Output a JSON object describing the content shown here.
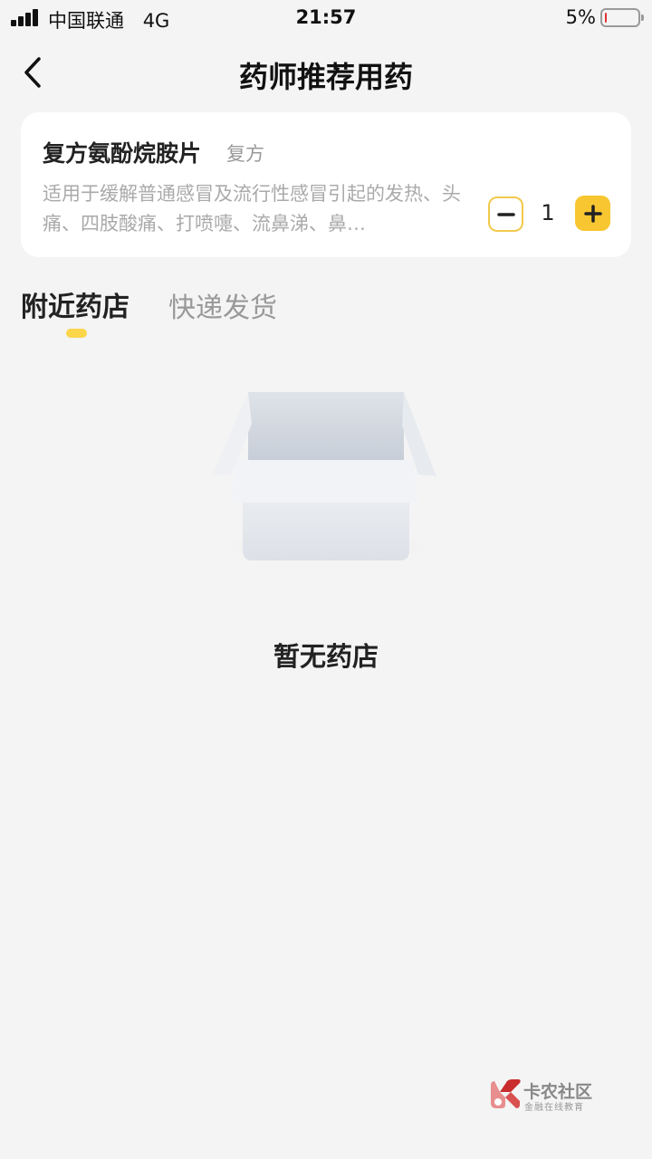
{
  "status_bar": {
    "carrier": "中国联通",
    "network": "4G",
    "time": "21:57",
    "battery_percent": "5%",
    "battery_level": 0.05,
    "battery_color": "#e33333"
  },
  "nav": {
    "title": "药师推荐用药",
    "back_icon": "chevron-left-icon"
  },
  "drug": {
    "name": "复方氨酚烷胺片",
    "tag": "复方",
    "description": "适用于缓解普通感冒及流行性感冒引起的发热、头痛、四肢酸痛、打喷嚏、流鼻涕、鼻…",
    "quantity": "1",
    "minus_icon": "minus-icon",
    "plus_icon": "plus-icon"
  },
  "tabs": [
    {
      "label": "附近药店",
      "active": true
    },
    {
      "label": "快递发货",
      "active": false
    }
  ],
  "empty_state": {
    "icon": "empty-box-icon",
    "message": "暂无药店"
  },
  "watermark": {
    "title": "卡农社区",
    "subtitle": "金融在线教育"
  },
  "colors": {
    "accent": "#f7c631",
    "background": "#f4f4f4",
    "card": "#ffffff",
    "muted_text": "#999999"
  }
}
